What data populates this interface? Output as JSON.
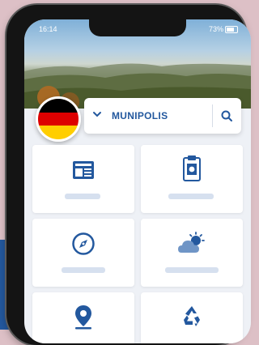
{
  "status_bar": {
    "time": "16:14",
    "battery": "73%"
  },
  "header": {
    "country_flag": [
      "#000000",
      "#dd0000",
      "#ffce00"
    ],
    "municipality_selector": {
      "label": "MUNIPOLIS"
    }
  },
  "tiles": [
    {
      "icon": "newspaper-icon"
    },
    {
      "icon": "clipboard-notice-icon"
    },
    {
      "icon": "compass-icon"
    },
    {
      "icon": "weather-cloud-sun-icon"
    },
    {
      "icon": "map-pin-icon"
    },
    {
      "icon": "recycle-icon"
    }
  ],
  "colors": {
    "accent": "#23589e",
    "background": "#ddc0c6",
    "tile_label": "#d6e0ef"
  }
}
